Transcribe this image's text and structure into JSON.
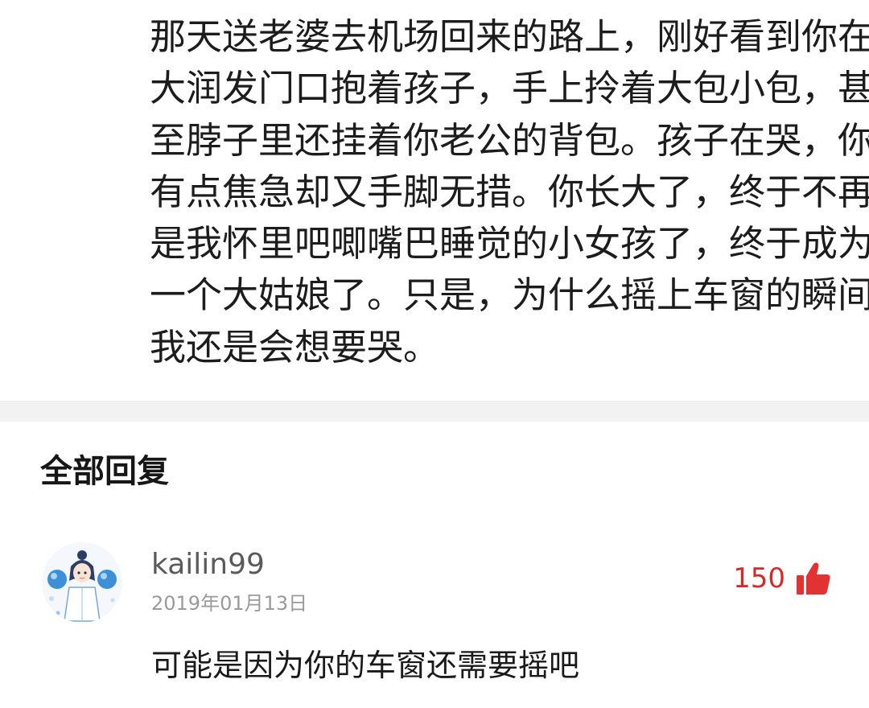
{
  "post": {
    "lines": [
      "那天送老婆去机场回来的路上，刚好看到你在",
      "大润发门口抱着孩子，手上拎着大包小包，甚",
      "至脖子里还挂着你老公的背包。孩子在哭，你",
      "有点焦急却又手脚无措。你长大了，终于不再",
      "是我怀里吧唧嘴巴睡觉的小女孩了，终于成为",
      "一个大姑娘了。只是，为什么摇上车窗的瞬间",
      "我还是会想要哭。"
    ]
  },
  "replies_section": {
    "title": "全部回复"
  },
  "reply": {
    "username": "kailin99",
    "date": "2019年01月13日",
    "likes": "150",
    "body": "可能是因为你的车窗还需要摇吧",
    "avatar_icon": "cartoon-avatar-icon",
    "like_icon": "thumbs-up-icon"
  },
  "colors": {
    "accent": "#d42a2a",
    "divider": "#f2f2f2",
    "muted": "#9a9a9a"
  }
}
